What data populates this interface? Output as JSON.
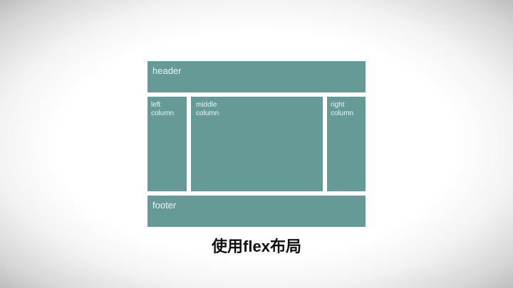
{
  "diagram": {
    "header": "header",
    "left_column": [
      "left",
      "column"
    ],
    "middle_column": [
      "middle",
      "column"
    ],
    "right_column": [
      "right",
      "column"
    ],
    "footer": "footer"
  },
  "caption": "使用flex布局",
  "colors": {
    "panel": "#659a97",
    "panel_text": "#eef6f5",
    "background_center": "#ffffff",
    "background_edge": "#bdbdbd",
    "caption_text": "#111111"
  }
}
